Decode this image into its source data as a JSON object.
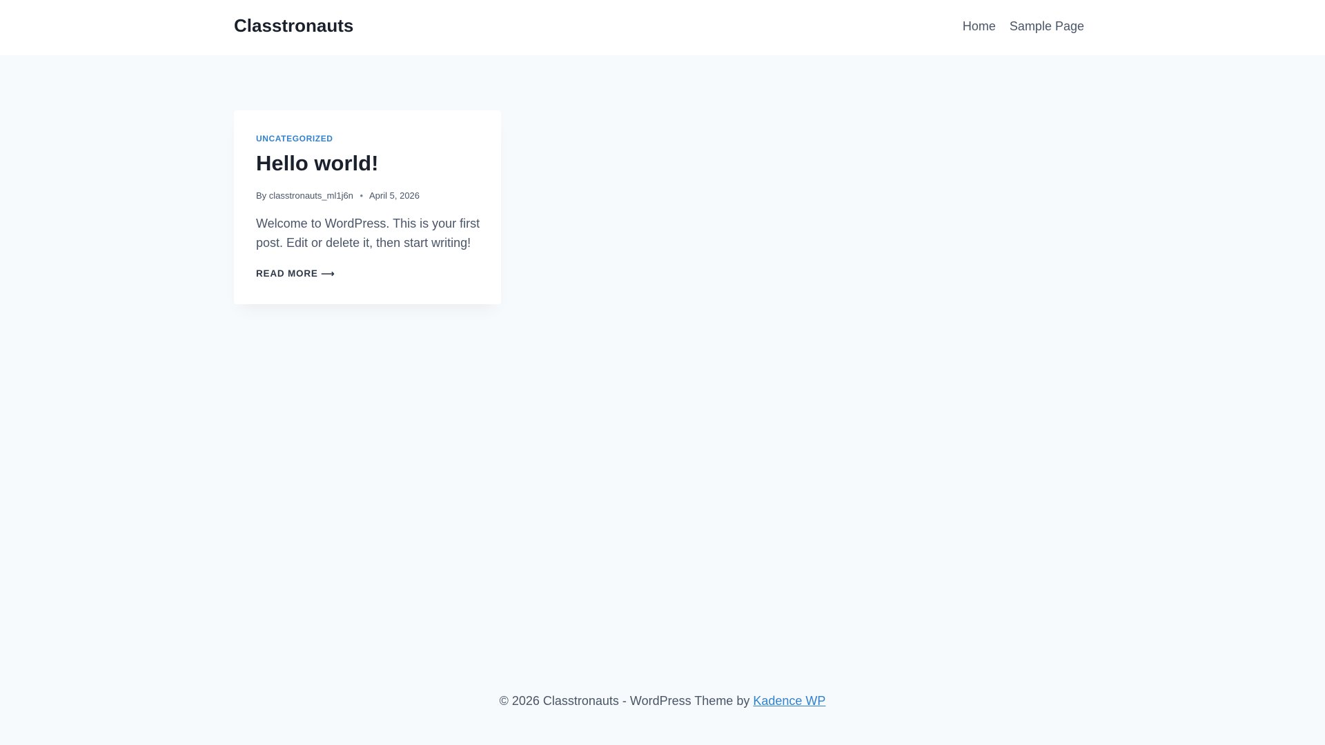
{
  "site": {
    "title": "Classtronauts"
  },
  "nav": [
    {
      "label": "Home"
    },
    {
      "label": "Sample Page"
    }
  ],
  "post": {
    "category": "UNCATEGORIZED",
    "title": "Hello world!",
    "by": "By",
    "author": "classtronauts_ml1j6n",
    "separator": "•",
    "date": "April 5, 2026",
    "excerpt": "Welcome to WordPress. This is your first post. Edit or delete it, then start writing!",
    "read_more": "READ MORE",
    "arrow": "⟶"
  },
  "footer": {
    "text": "© 2026 Classtronauts - WordPress Theme by ",
    "link": "Kadence WP"
  }
}
